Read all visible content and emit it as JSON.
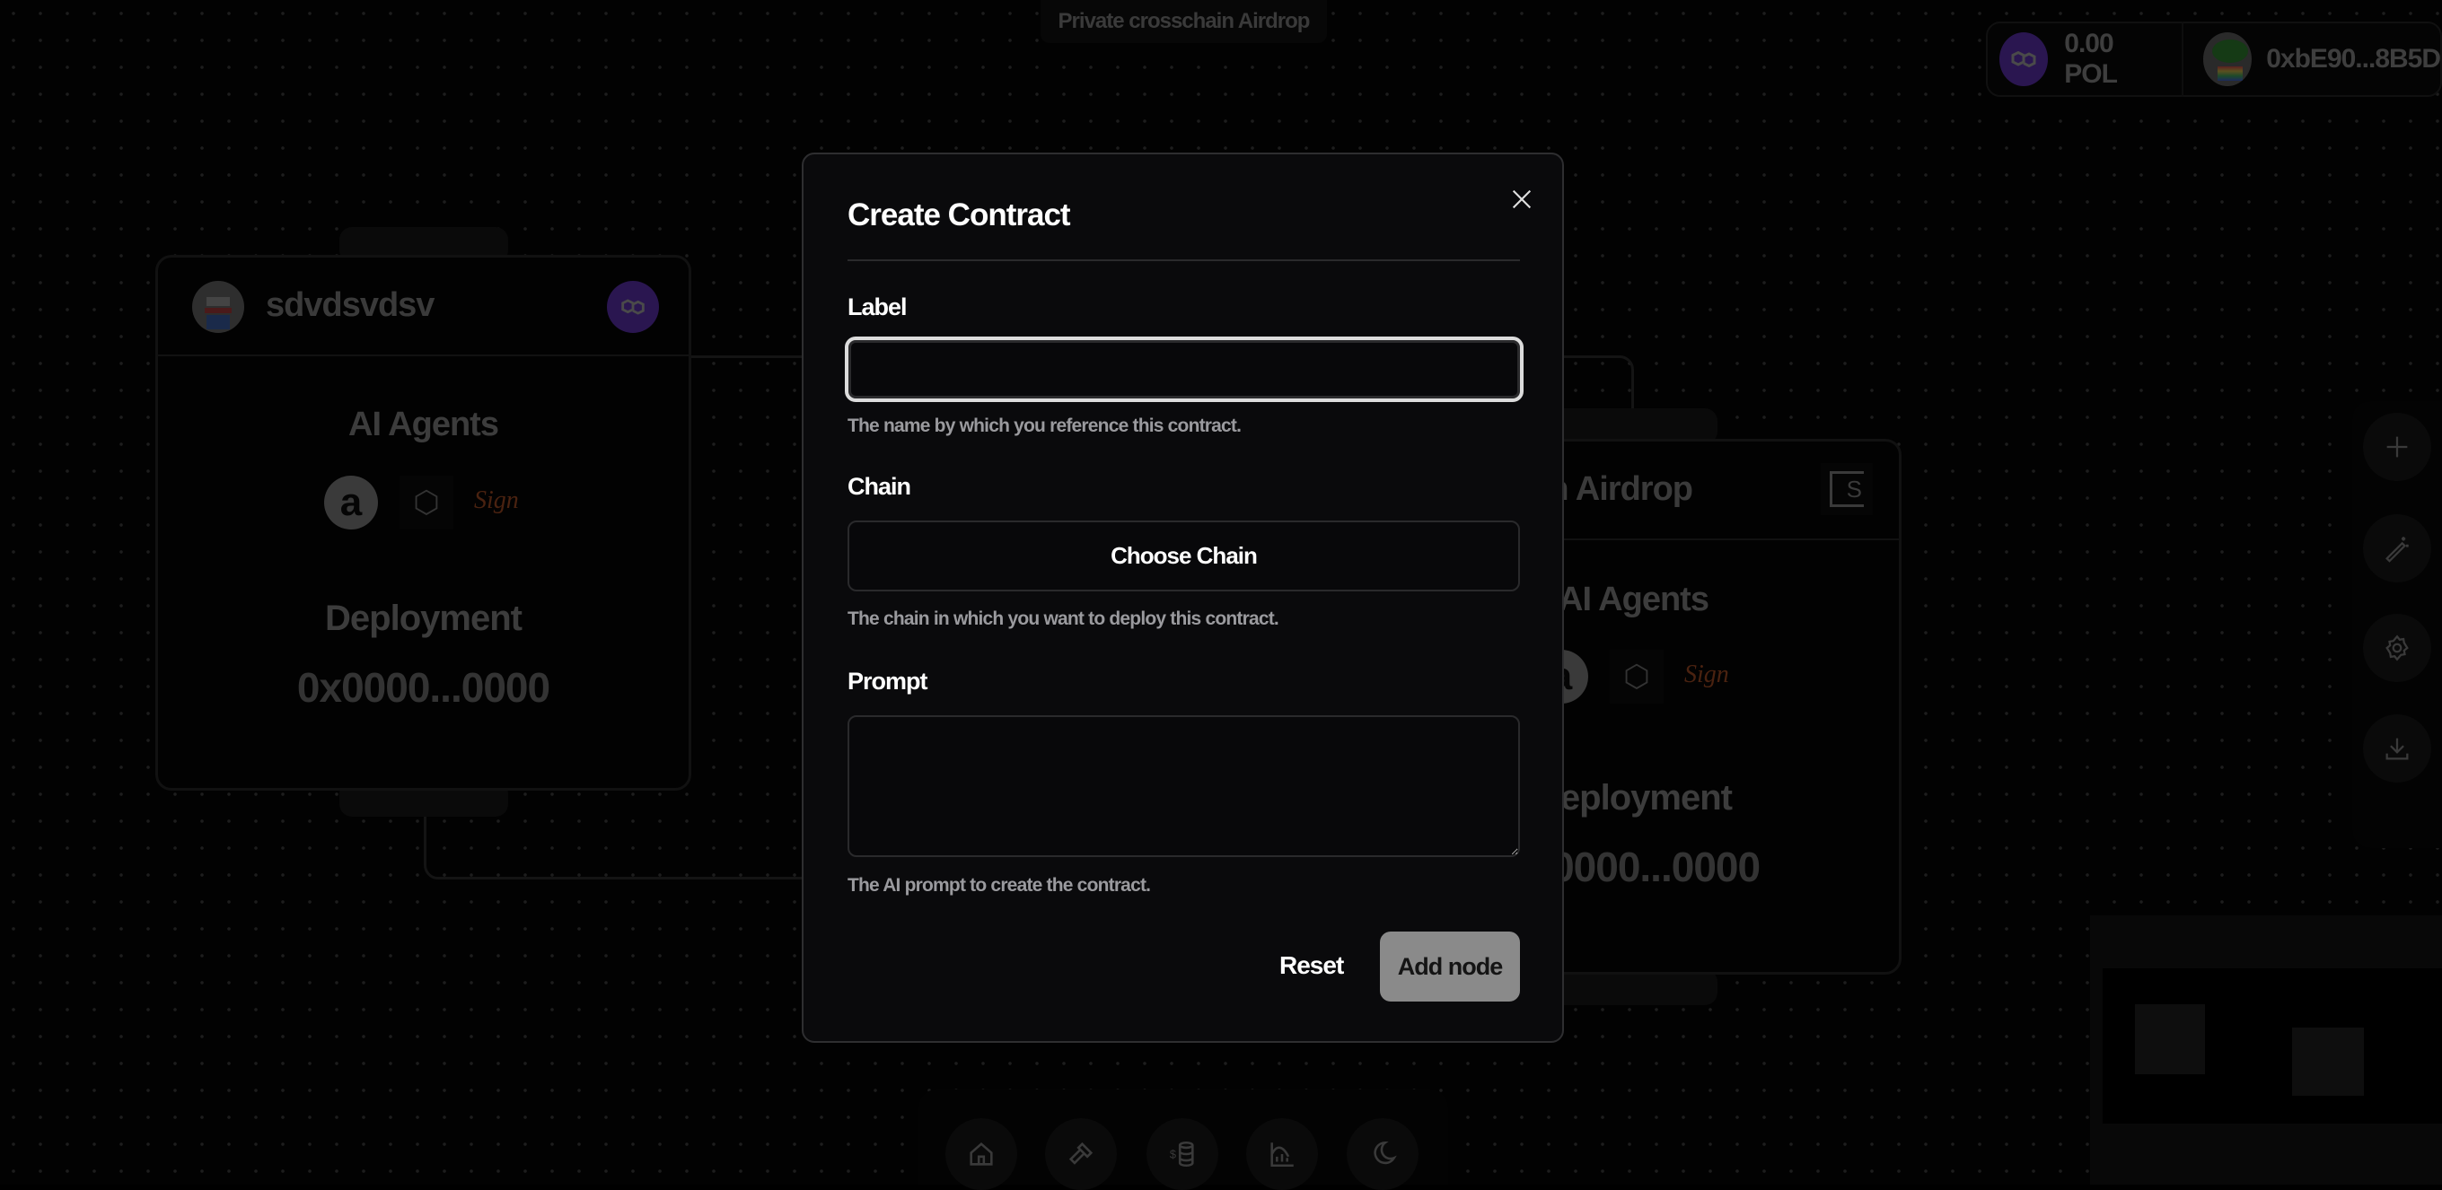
{
  "header": {
    "title": "Private crosschain Airdrop"
  },
  "wallet": {
    "balance": "0.00 POL",
    "address": "0xbE90...8B5D",
    "chain_icon": "polygon-icon",
    "avatar": "pepe-avatar"
  },
  "nodes": [
    {
      "name": "sdvdsvdsv",
      "chain_icon": "polygon-icon",
      "agents_label": "AI Agents",
      "agents": [
        "brian-logo",
        "cube-logo",
        "sign-logo"
      ],
      "sign_text": "Sign",
      "deployment_label": "Deployment",
      "address": "0x0000...0000"
    },
    {
      "name": "Private crosschain Airdrop",
      "chain_icon": "s-wallet-icon",
      "chain_glyph": "S",
      "agents_label": "AI Agents",
      "agents": [
        "brian-logo",
        "cube-logo",
        "sign-logo"
      ],
      "sign_text": "Sign",
      "deployment_label": "Deployment",
      "address": "0x0000...0000"
    }
  ],
  "right_toolbar": [
    "plus-icon",
    "magic-wand-icon",
    "gear-icon",
    "download-icon"
  ],
  "dock": [
    "home-icon",
    "hammer-icon",
    "coins-icon",
    "chart-icon",
    "moon-icon"
  ],
  "modal": {
    "title": "Create Contract",
    "label_field": {
      "label": "Label",
      "value": "",
      "help": "The name by which you reference this contract."
    },
    "chain_field": {
      "label": "Chain",
      "button": "Choose Chain",
      "help": "The chain in which you want to deploy this contract."
    },
    "prompt_field": {
      "label": "Prompt",
      "value": "",
      "help": "The AI prompt to create the contract."
    },
    "reset": "Reset",
    "submit": "Add node"
  },
  "colors": {
    "polygon": "#2a1650",
    "submit_bg": "#8a8a8a",
    "sign": "#5a2a10"
  }
}
